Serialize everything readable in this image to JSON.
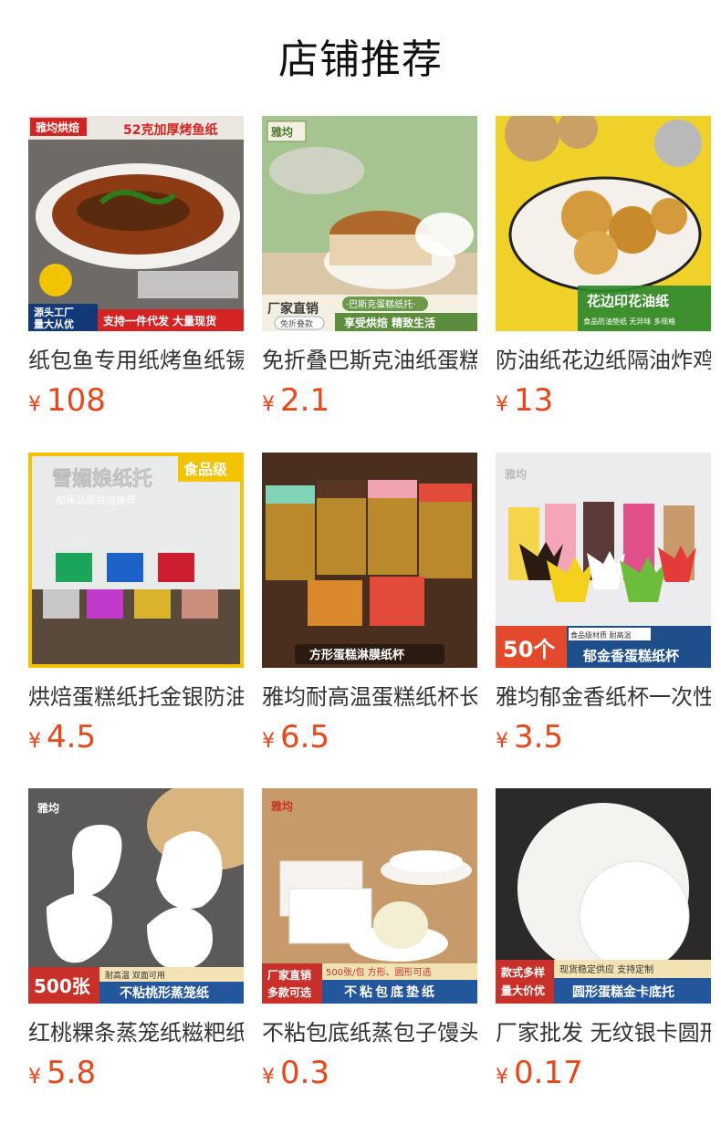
{
  "page": {
    "title": "店铺推荐",
    "currency": "¥"
  },
  "products": [
    {
      "name": "纸包鱼专用纸烤鱼纸锡纸",
      "price": "108",
      "icon": "grilled-fish-paper-image",
      "overlay": {
        "brand": "雅均烘焙",
        "headline": "52克加厚烤鱼纸",
        "sub": "",
        "badge_top": "源头工厂",
        "badge_bottom": "量大从优",
        "slogan": "支持一件代发 大量现货"
      }
    },
    {
      "name": "免折叠巴斯克油纸蛋糕纸托",
      "price": "2.1",
      "icon": "basque-cake-paper-image",
      "overlay": {
        "brand": "雅均",
        "headline": "·巴斯克蛋糕纸托·",
        "sub": "",
        "badge_top": "厂家直销",
        "badge_bottom": "免折叠款",
        "slogan": "享受烘焙 精致生活"
      }
    },
    {
      "name": "防油纸花边纸隔油炸鸡纸",
      "price": "13",
      "icon": "fried-chicken-basket-image",
      "overlay": {
        "brand": "",
        "headline": "花边印花油纸",
        "sub": "食品防油垫纸 无异味 多规格",
        "badge_top": "",
        "badge_bottom": "",
        "slogan": ""
      }
    },
    {
      "name": "烘焙蛋糕纸托金银防油纸杯",
      "price": "4.5",
      "icon": "cupcake-liners-image",
      "overlay": {
        "brand": "",
        "headline": "雪媚娘纸托",
        "sub": "加厚品质烘焙推荐",
        "badge_top": "食品级",
        "badge_bottom": "",
        "slogan": ""
      }
    },
    {
      "name": "雅均耐高温蛋糕纸杯长方形",
      "price": "6.5",
      "icon": "square-cake-cups-image",
      "overlay": {
        "brand": "",
        "headline": "",
        "sub": "",
        "badge_top": "",
        "badge_bottom": "",
        "slogan": "方形蛋糕淋膜纸杯"
      }
    },
    {
      "name": "雅均郁金香纸杯一次性蛋糕杯",
      "price": "3.5",
      "icon": "tulip-cups-image",
      "overlay": {
        "brand": "雅均",
        "headline": "",
        "sub": "食品级材质 耐高温",
        "badge_top": "50个",
        "badge_bottom": "",
        "slogan": "郁金香蛋糕纸杯"
      }
    },
    {
      "name": "红桃粿条蒸笼纸糍粑纸垫",
      "price": "5.8",
      "icon": "peach-steamer-paper-image",
      "overlay": {
        "brand": "雅均",
        "headline": "",
        "sub": "耐高温 双面可用",
        "badge_top": "500张",
        "badge_bottom": "",
        "slogan": "不粘桃形蒸笼纸"
      }
    },
    {
      "name": "不粘包底纸蒸包子馒头垫纸",
      "price": "0.3",
      "icon": "bun-bottom-paper-image",
      "overlay": {
        "brand": "雅均",
        "headline": "",
        "sub": "500张/包  方形、圆形可选",
        "badge_top": "厂家直销",
        "badge_bottom": "多款可选",
        "slogan": "不粘包底垫纸"
      }
    },
    {
      "name": "厂家批发 无纹银卡圆形垫",
      "price": "0.17",
      "icon": "round-cake-board-image",
      "overlay": {
        "brand": "",
        "headline": "",
        "sub": "现货稳定供应 支持定制",
        "badge_top": "款式多样",
        "badge_bottom": "量大价优",
        "slogan": "圆形蛋糕金卡底托"
      }
    }
  ]
}
